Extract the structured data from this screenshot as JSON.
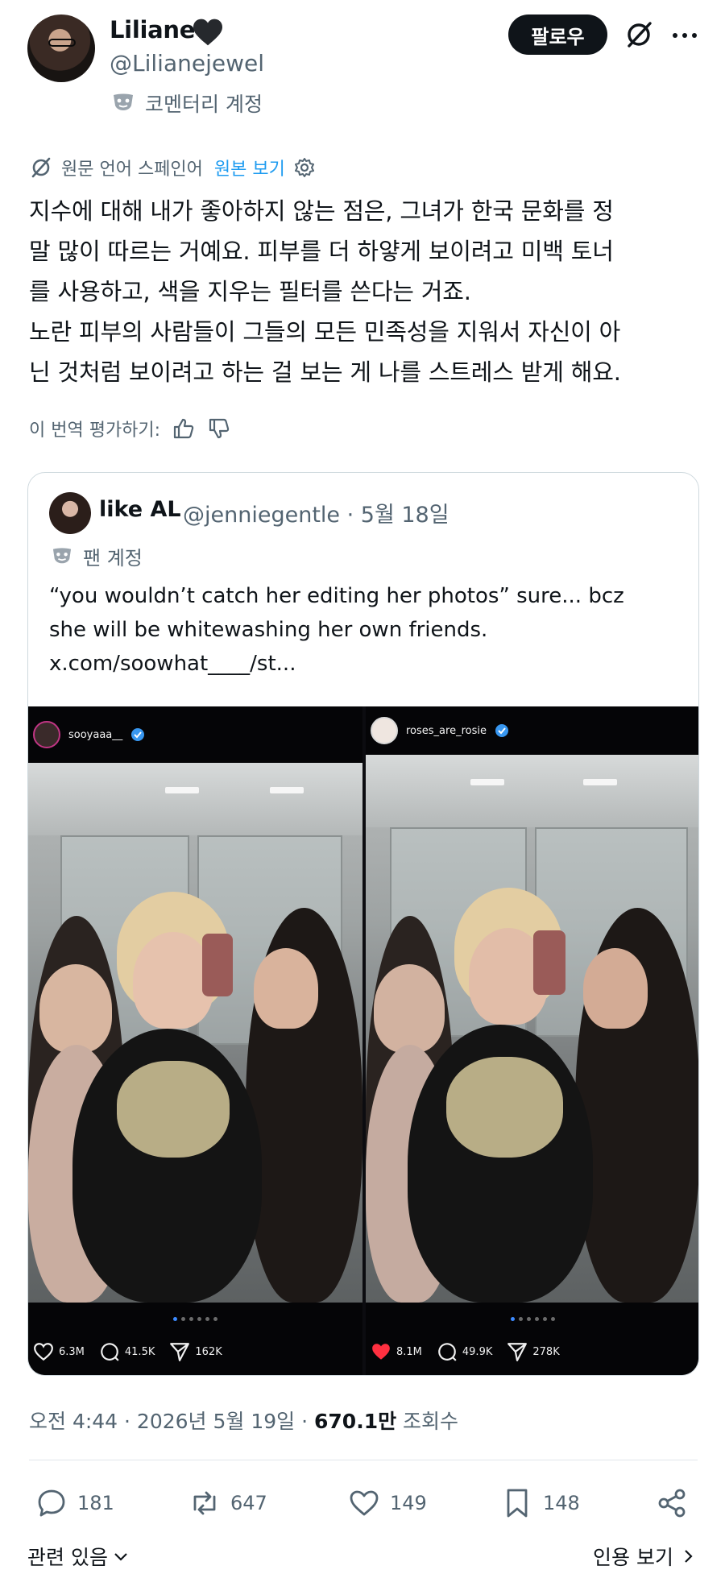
{
  "author": {
    "display_name": "Liliane",
    "handle": "@Lilianejewel",
    "badge_icon": "black-heart-icon",
    "account_label": "코멘터리 계정"
  },
  "header": {
    "follow_label": "팔로우",
    "grok_icon": "slashed-circle-icon",
    "more_icon": "more-icon"
  },
  "translation": {
    "source_label": "원문 언어 스페인어",
    "view_original_label": "원본 보기",
    "rate_label": "이 번역 평가하기:"
  },
  "post": {
    "lines": [
      "지수에 대해 내가 좋아하지 않는 점은, 그녀가 한국 문화를 정",
      "말 많이 따르는 거예요. 피부를 더 하얗게 보이려고 미백 토너",
      "를 사용하고, 색을 지우는 필터를 쓴다는 거죠.",
      "노란 피부의 사람들이 그들의 모든 민족성을 지워서 자신이 아",
      "닌 것처럼 보이려고 하는 걸 보는 게 나를 스트레스 받게 해요."
    ]
  },
  "quote": {
    "display_name": "like AL",
    "handle_date": "@jenniegentle · 5월 18일",
    "account_label": "팬 계정",
    "lines": [
      "“you wouldn’t catch her editing her photos” sure... bcz",
      "she will be whitewashing her own friends.",
      "x.com/soowhat____/st..."
    ],
    "panels": [
      {
        "username": "sooyaaa__",
        "likes": "6.3M",
        "comments": "41.5K",
        "shares": "162K",
        "liked": false
      },
      {
        "username": "roses_are_rosie",
        "likes": "8.1M",
        "comments": "49.9K",
        "shares": "278K",
        "liked": true
      }
    ]
  },
  "footer": {
    "time_date": "오전 4:44 · 2026년 5월 19일 · ",
    "views_count": "670.1만",
    "views_label": " 조회수",
    "replies": "181",
    "reposts": "647",
    "likes": "149",
    "bookmarks": "148",
    "related_label": "관련 있음",
    "quotes_label": "인용 보기"
  },
  "colors": {
    "accent": "#1d9bf0",
    "text": "#0f1419",
    "muted": "#536471",
    "ig_like_red": "#ff3040"
  }
}
